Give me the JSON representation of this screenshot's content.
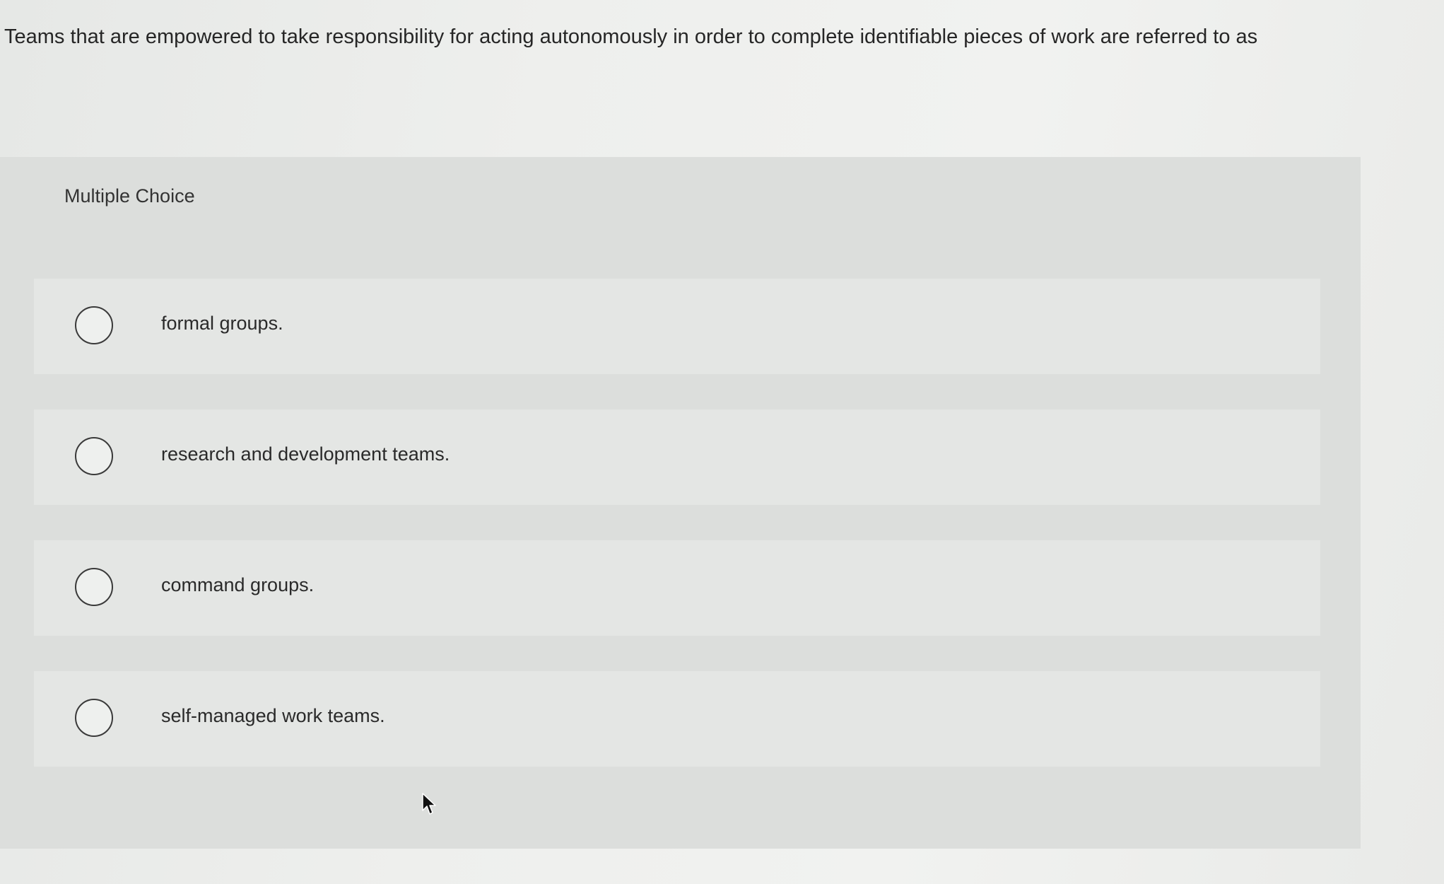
{
  "question": {
    "text": "Teams that are empowered to take responsibility for acting autonomously in order to complete identifiable pieces of work are referred to as"
  },
  "panel": {
    "label": "Multiple Choice"
  },
  "options": [
    {
      "label": "formal groups."
    },
    {
      "label": "research and development teams."
    },
    {
      "label": "command groups."
    },
    {
      "label": "self-managed work teams."
    }
  ],
  "icons": {
    "radio": "radio-button-icon",
    "cursor": "mouse-pointer-icon"
  }
}
